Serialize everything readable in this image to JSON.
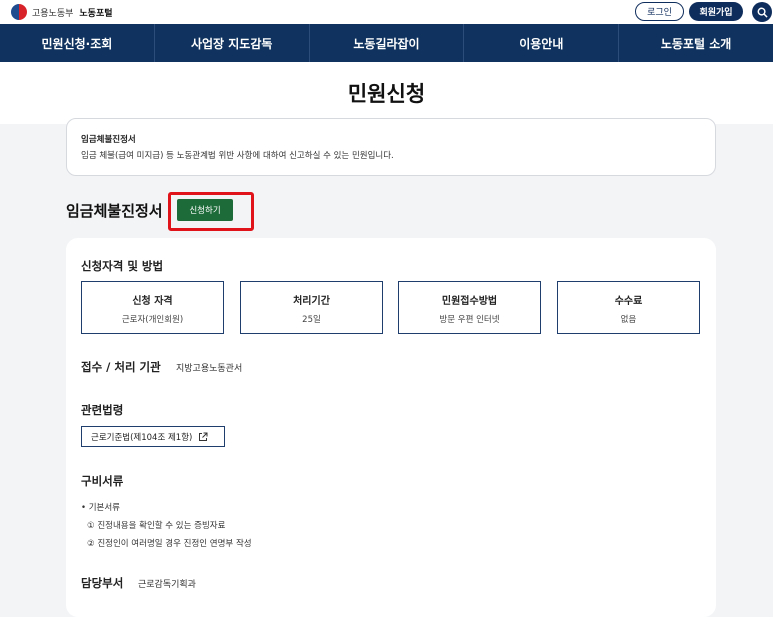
{
  "header": {
    "ministry": "고용노동부",
    "portal": "노동포털",
    "login_label": "로그인",
    "join_label": "회원가입",
    "search_icon": "search-icon",
    "accent": "#0f2d5c"
  },
  "nav": {
    "items": [
      {
        "label": "민원신청·조회"
      },
      {
        "label": "사업장 지도감독"
      },
      {
        "label": "노동길라잡이"
      },
      {
        "label": "이용안내"
      },
      {
        "label": "노동포털 소개"
      }
    ]
  },
  "page_title": "민원신청",
  "summary": {
    "title": "임금체불진정서",
    "description": "임금 체불(급여 미지급) 등 노동관계법 위반 사항에 대하여 신고하실 수 있는 민원입니다."
  },
  "main": {
    "heading": "임금체불진정서",
    "apply_label": "신청하기",
    "apply_color": "#1e6b3a",
    "highlight_color": "#e0121a"
  },
  "eligibility": {
    "title": "신청자격 및 방법",
    "boxes": [
      {
        "label": "신청 자격",
        "value": "근로자(개인회원)"
      },
      {
        "label": "처리기간",
        "value": "25일"
      },
      {
        "label": "민원접수방법",
        "value": "방문 우편 인터넷"
      },
      {
        "label": "수수료",
        "value": "없음"
      }
    ]
  },
  "agency": {
    "title": "접수 / 처리 기관",
    "value": "지방고용노동관서"
  },
  "law": {
    "title": "관련법령",
    "link_label": "근로기준법(제104조 제1항)",
    "link_icon": "external-link-icon"
  },
  "documents": {
    "title": "구비서류",
    "basic_label": "• 기본서류",
    "items": [
      "① 진정내용을 확인할 수 있는 증빙자료",
      "② 진정인이 여러명일 경우 진정인 연명부 작성"
    ]
  },
  "department": {
    "title": "담당부서",
    "value": "근로감독기획과"
  }
}
